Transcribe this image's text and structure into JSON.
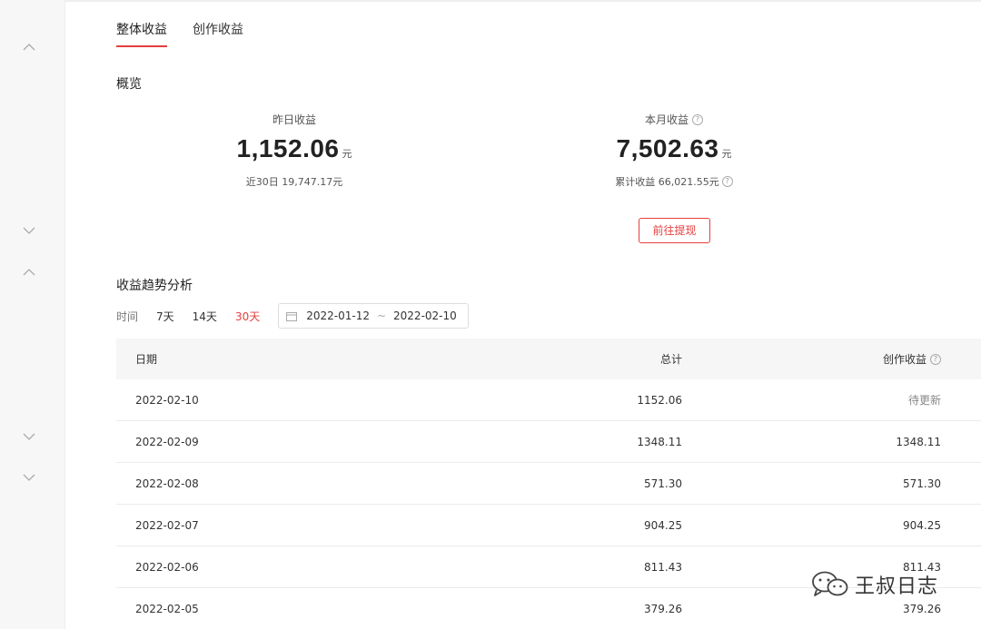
{
  "tabs": [
    {
      "label": "整体收益",
      "active": true
    },
    {
      "label": "创作收益",
      "active": false
    }
  ],
  "overview": {
    "title": "概览",
    "yesterday": {
      "label": "昨日收益",
      "value": "1,152.06",
      "unit": "元",
      "sub": "近30日 19,747.17元"
    },
    "month": {
      "label": "本月收益",
      "value": "7,502.63",
      "unit": "元",
      "sub": "累计收益 66,021.55元"
    },
    "withdraw_label": "前往提现"
  },
  "trend": {
    "title": "收益趋势分析",
    "time_label": "时间",
    "options": [
      {
        "label": "7天",
        "active": false
      },
      {
        "label": "14天",
        "active": false
      },
      {
        "label": "30天",
        "active": true
      }
    ],
    "date_start": "2022-01-12",
    "date_sep": "~",
    "date_end": "2022-02-10"
  },
  "table": {
    "headers": {
      "date": "日期",
      "total": "总计",
      "create": "创作收益"
    },
    "rows": [
      {
        "date": "2022-02-10",
        "total": "1152.06",
        "create": "待更新"
      },
      {
        "date": "2022-02-09",
        "total": "1348.11",
        "create": "1348.11"
      },
      {
        "date": "2022-02-08",
        "total": "571.30",
        "create": "571.30"
      },
      {
        "date": "2022-02-07",
        "total": "904.25",
        "create": "904.25"
      },
      {
        "date": "2022-02-06",
        "total": "811.43",
        "create": "811.43"
      },
      {
        "date": "2022-02-05",
        "total": "379.26",
        "create": "379.26"
      }
    ]
  },
  "watermark": {
    "text": "王叔日志",
    "icon": "wechat-icon"
  },
  "help_glyph": "?",
  "colors": {
    "accent": "#e53e3e",
    "sidebar_bg": "#f7f7f7",
    "header_bg": "#f6f6f6"
  }
}
